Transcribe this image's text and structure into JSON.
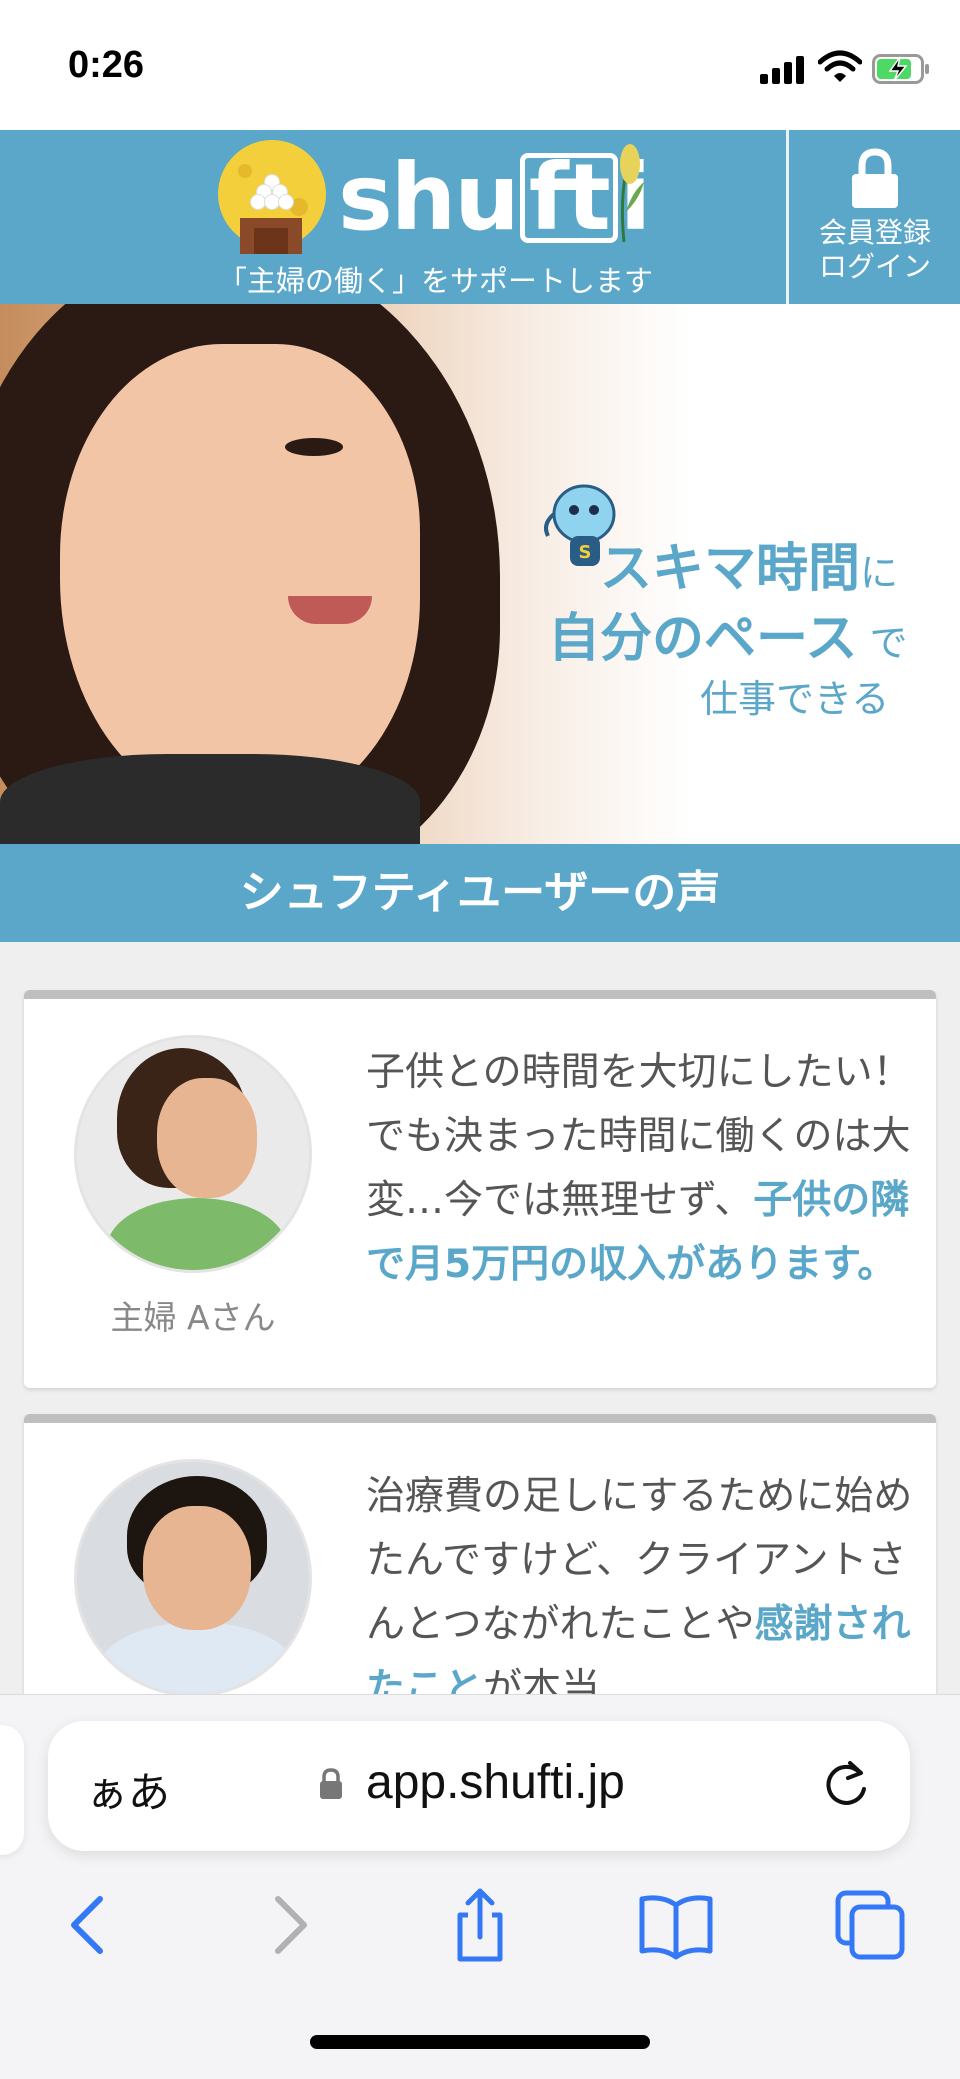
{
  "status_bar": {
    "time": "0:26"
  },
  "header": {
    "logo_text": {
      "part1": "shu",
      "part2": "ft",
      "part3": "i"
    },
    "tagline": "「主婦の働く」をサポートします",
    "login": {
      "line1": "会員登録",
      "line2": "ログイン"
    },
    "icons": [
      "dango-moon-logo-icon",
      "lock-icon"
    ]
  },
  "hero": {
    "line1_main": "スキマ時間",
    "line1_suffix": "に",
    "line2_main": "自分のペース",
    "line2_suffix": "で",
    "line3": "仕事できる"
  },
  "section": {
    "title": "シュフティユーザーの声"
  },
  "testimonials": [
    {
      "name": "主婦 Aさん",
      "text_plain": "子供との時間を大切にしたい！でも決まった時間に働くのは大変…今では無理せず、",
      "text_highlight": "子供の隣で月5万円の収入があります。"
    },
    {
      "text_plain": "治療費の足しにするために始めたんですけど、クライアントさんとつながれたことや",
      "text_highlight": "感謝されたこと",
      "text_tail": "が本当"
    }
  ],
  "browser": {
    "aa_label": "ぁあ",
    "url": "app.shufti.jp",
    "accent_color": "#3478f6",
    "toolbar": [
      "back-icon",
      "forward-icon",
      "share-icon",
      "bookmarks-icon",
      "tabs-icon"
    ]
  },
  "colors": {
    "brand": "#5aa7ca",
    "card_border": "#bfbfbf"
  }
}
